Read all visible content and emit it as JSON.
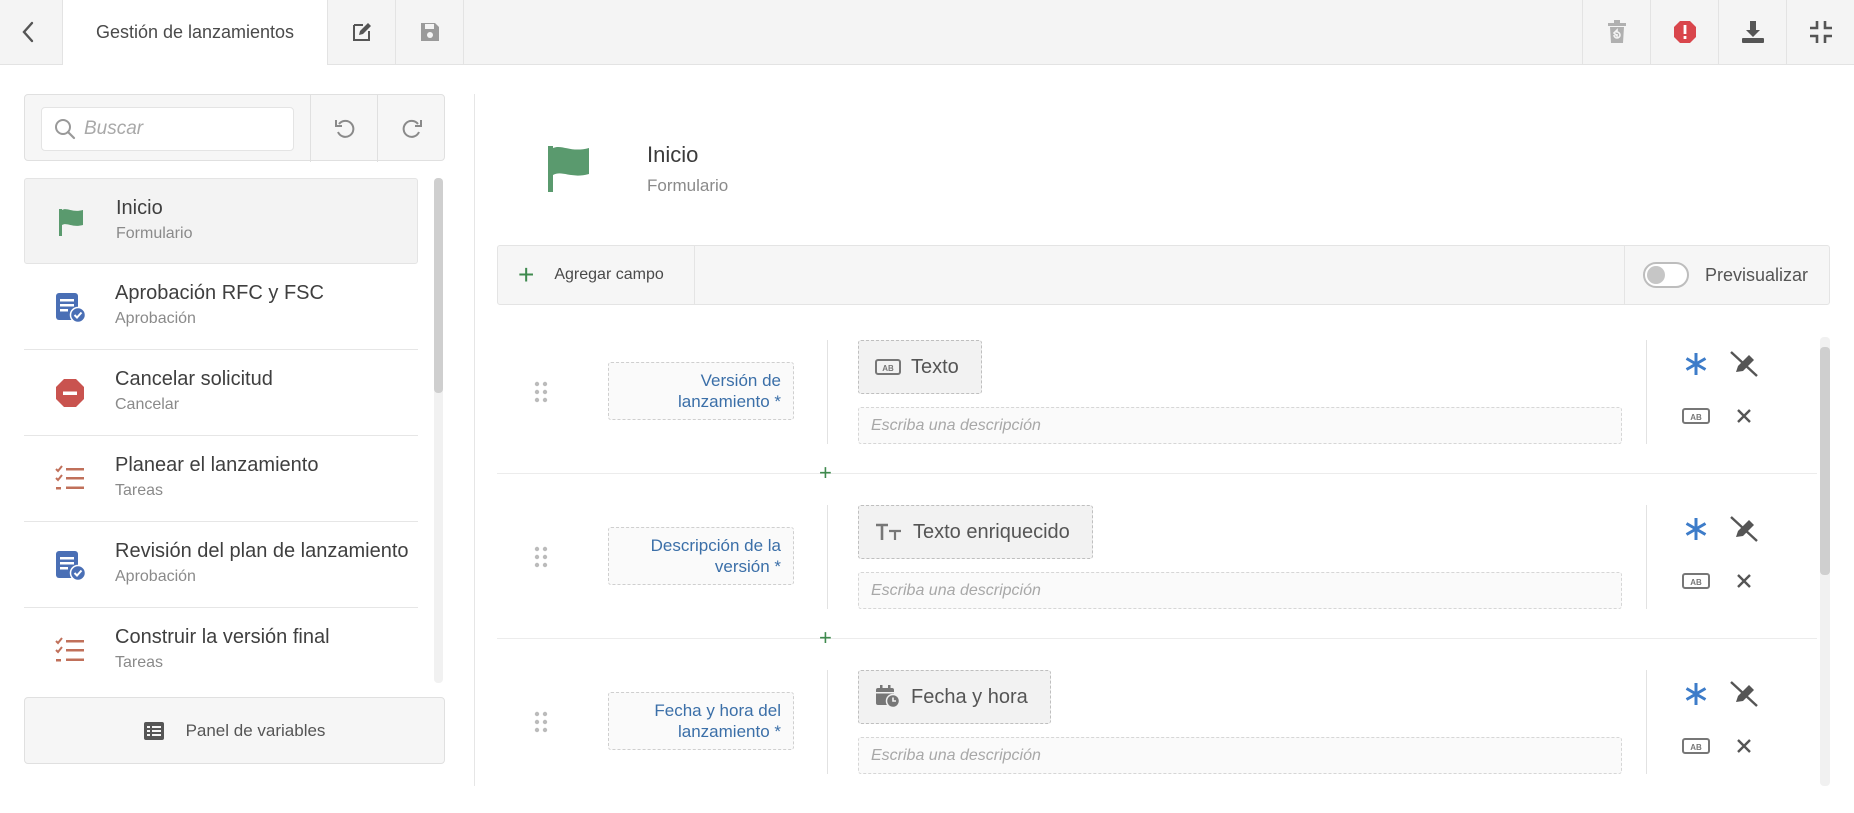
{
  "topbar": {
    "tab_title": "Gestión de lanzamientos",
    "icons": [
      "chevron-left-icon",
      "edit-icon",
      "save-icon",
      "trash-restore-icon",
      "alert-icon",
      "download-icon",
      "compress-icon"
    ]
  },
  "sidebar": {
    "search_placeholder": "Buscar",
    "steps": [
      {
        "title": "Inicio",
        "subtitle": "Formulario",
        "icon": "flag-icon",
        "color": "#5a9a6e"
      },
      {
        "title": "Aprobación RFC y FSC",
        "subtitle": "Aprobación",
        "icon": "approval-icon",
        "color": "#4a6fb5"
      },
      {
        "title": "Cancelar solicitud",
        "subtitle": "Cancelar",
        "icon": "cancel-icon",
        "color": "#c9534f"
      },
      {
        "title": "Planear el lanzamiento",
        "subtitle": "Tareas",
        "icon": "tasks-icon",
        "color": "#c0705a"
      },
      {
        "title": "Revisión del plan de lanzamiento",
        "subtitle": "Aprobación",
        "icon": "approval-icon",
        "color": "#4a6fb5"
      },
      {
        "title": "Construir la versión final",
        "subtitle": "Tareas",
        "icon": "tasks-icon",
        "color": "#c0705a"
      }
    ],
    "variables_panel_label": "Panel de variables"
  },
  "main": {
    "title": "Inicio",
    "subtitle": "Formulario",
    "add_field_label": "Agregar campo",
    "preview_label": "Previsualizar",
    "preview_on": false,
    "fields": [
      {
        "label": "Versión de lanzamiento *",
        "type": "Texto",
        "type_icon": "text-field-icon",
        "description_placeholder": "Escriba una descripción"
      },
      {
        "label": "Descripción de la versión *",
        "type": "Texto enriquecido",
        "type_icon": "rich-text-icon",
        "description_placeholder": "Escriba una descripción"
      },
      {
        "label": "Fecha y hora del lanzamiento *",
        "type": "Fecha y hora",
        "type_icon": "calendar-clock-icon",
        "description_placeholder": "Escriba una descripción"
      }
    ]
  },
  "colors": {
    "accent_blue": "#3b6fa8",
    "green": "#3f8a4e",
    "required_star": "#3d7cc9",
    "alert_red": "#d9464c"
  }
}
